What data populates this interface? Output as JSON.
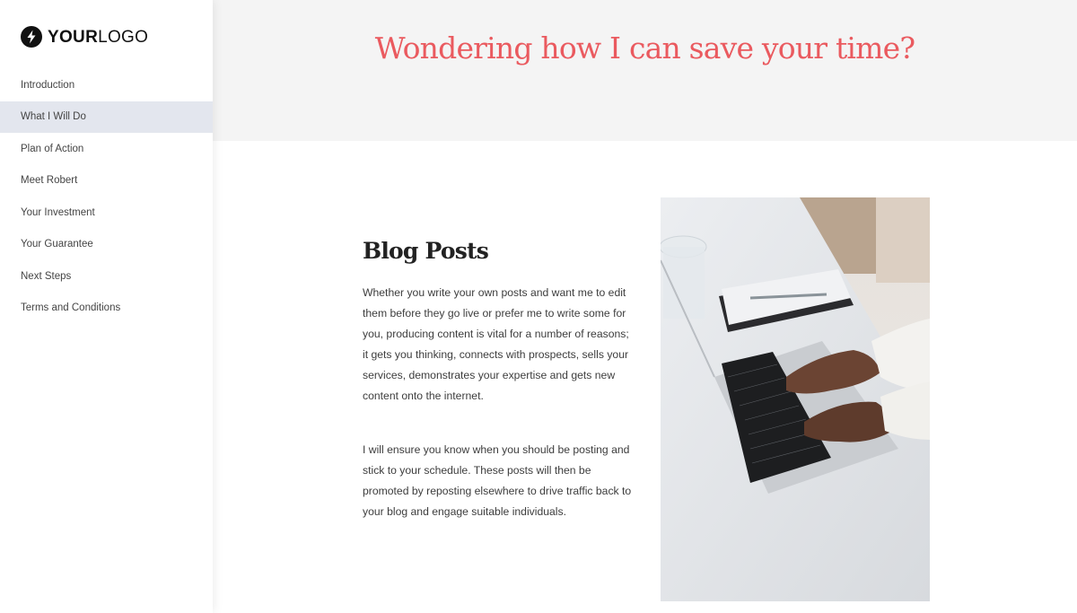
{
  "logo": {
    "icon": "lightning-bolt-icon",
    "bold_text": "YOUR",
    "light_text": "LOGO"
  },
  "sidebar": {
    "items": [
      {
        "label": "Introduction",
        "active": false
      },
      {
        "label": "What I Will Do",
        "active": true
      },
      {
        "label": "Plan of Action",
        "active": false
      },
      {
        "label": "Meet Robert",
        "active": false
      },
      {
        "label": "Your Investment",
        "active": false
      },
      {
        "label": "Your Guarantee",
        "active": false
      },
      {
        "label": "Next Steps",
        "active": false
      },
      {
        "label": "Terms and Conditions",
        "active": false
      }
    ]
  },
  "header": {
    "title": "Wondering how I can save your time?"
  },
  "section": {
    "title": "Blog Posts",
    "paragraphs": [
      "Whether you write your own posts and want me to edit them before they go live or prefer me to write some for you, producing content is vital for a number of reasons; it gets you thinking, connects with prospects,  sells your services, demonstrates your expertise and gets new content onto the internet.",
      "I will ensure you know when you should be posting and stick to your schedule. These posts will then be promoted by reposting elsewhere to drive traffic back to your blog and engage suitable individuals."
    ],
    "image_description": "Hands typing on a laptop on a white desk with a glass of water and a notebook"
  },
  "colors": {
    "accent": "#ea5a5f",
    "header_bg": "#f4f4f4",
    "active_nav_bg": "#e3e6ee"
  }
}
